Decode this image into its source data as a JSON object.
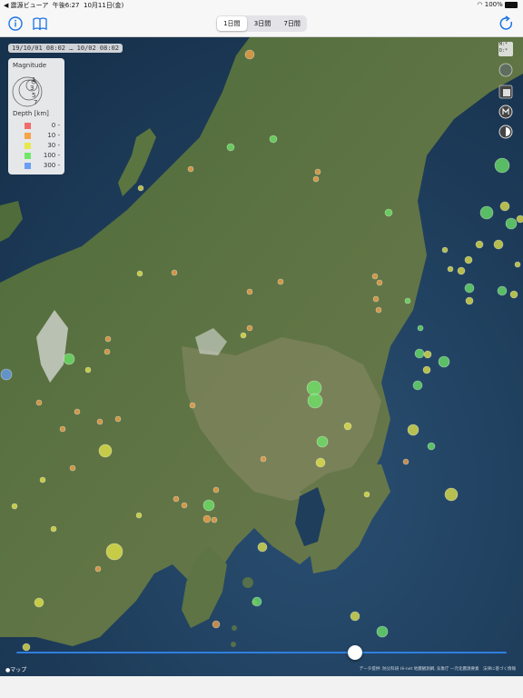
{
  "status_bar": {
    "back_label": "◀ 震源ビューア",
    "time": "午後6:27",
    "date": "10月11日(金)",
    "battery": "100%"
  },
  "nav": {
    "tabs": [
      "1日間",
      "3日間",
      "7日間"
    ],
    "active_tab": "1日間",
    "info_icon": "info-icon",
    "book_icon": "book-icon",
    "refresh_icon": "refresh-icon"
  },
  "map": {
    "date_range": "19/10/01 08:02 … 10/02 08:02",
    "legend": {
      "magnitude_title": "Magnitude",
      "magnitudes": [
        "1",
        "3",
        "5",
        "7"
      ],
      "depth_title": "Depth [km]",
      "depths": [
        {
          "label": "0 -",
          "color": "#f46a6a"
        },
        {
          "label": "10 -",
          "color": "#f7a34a"
        },
        {
          "label": "30 -",
          "color": "#e8e84a"
        },
        {
          "label": "100 -",
          "color": "#6fe86a"
        },
        {
          "label": "300 -",
          "color": "#6a9ef4"
        }
      ]
    },
    "map_keys_label": "M:*\nD:*",
    "apple_maps": "マップ",
    "credits": "データ提供: 防災科研 Hi-net 地震観測網, 気象庁 一元化震源要素　法律に基づく情報"
  },
  "slider": {
    "position": 0.69
  }
}
